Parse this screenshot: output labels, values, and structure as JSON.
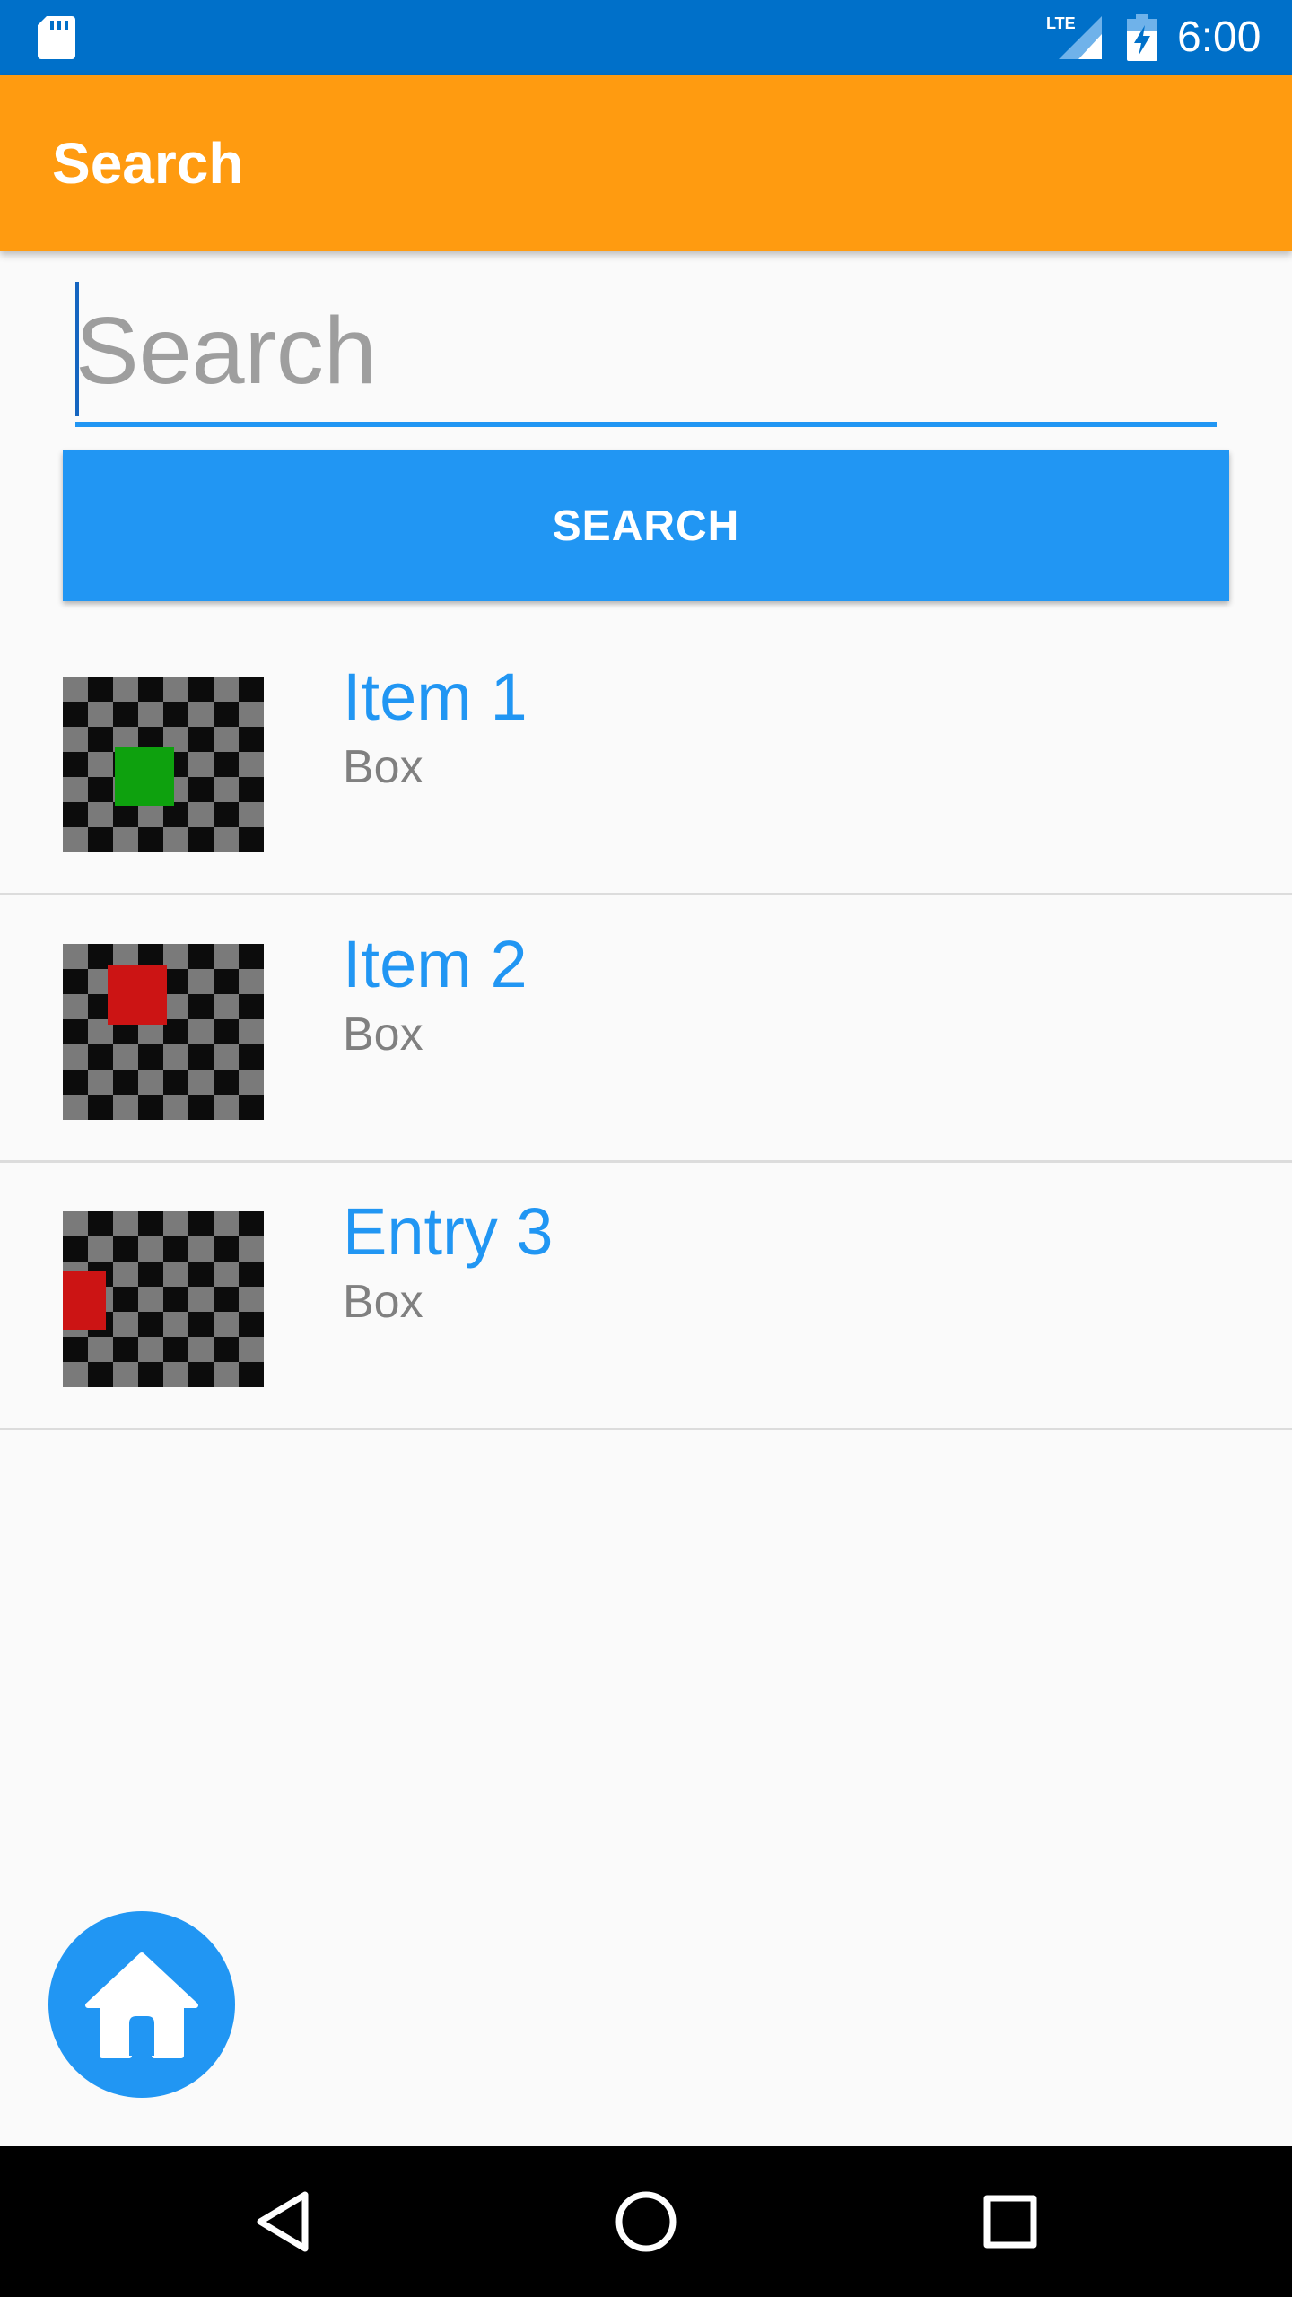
{
  "status_bar": {
    "time": "6:00",
    "network_label": "LTE",
    "icons": [
      "sd-card-icon",
      "lte-signal-icon",
      "battery-charging-icon"
    ]
  },
  "app_bar": {
    "title": "Search"
  },
  "search": {
    "placeholder": "Search",
    "value": "",
    "button_label": "SEARCH"
  },
  "items": [
    {
      "title": "Item 1",
      "subtitle": "Box",
      "marker_color": "#0ea10e"
    },
    {
      "title": "Item 2",
      "subtitle": "Box",
      "marker_color": "#cc1414"
    },
    {
      "title": "Entry 3",
      "subtitle": "Box",
      "marker_color": "#cc1414"
    }
  ],
  "fab": {
    "icon": "home-icon"
  },
  "nav_bar": {
    "icons": [
      "back-icon",
      "home-circle-icon",
      "recents-icon"
    ]
  },
  "colors": {
    "status_bar": "#0070c9",
    "app_bar": "#ff9b10",
    "accent": "#2196f3",
    "subtitle": "#808080",
    "background": "#fafafa"
  }
}
